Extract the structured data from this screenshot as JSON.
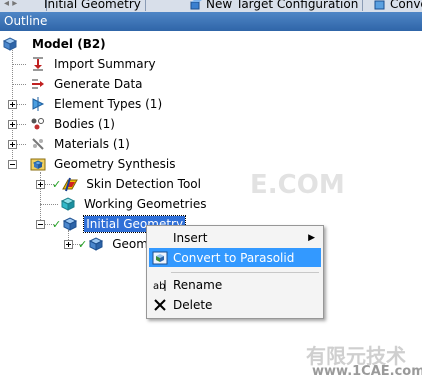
{
  "tabs": [
    {
      "label": "Initial Geometry",
      "icon": "geometry-icon"
    },
    {
      "label": "New Target Configuration",
      "icon": "cube-icon"
    },
    {
      "label": "Conve",
      "icon": "convert-icon"
    }
  ],
  "outline": {
    "title": "Outline"
  },
  "tree": {
    "root": "Model (B2)",
    "items": {
      "import_summary": "Import Summary",
      "generate_data": "Generate Data",
      "element_types": "Element Types (1)",
      "bodies": "Bodies (1)",
      "materials": "Materials (1)",
      "geometry_synthesis": "Geometry Synthesis",
      "skin_detection": "Skin Detection Tool",
      "working_geometries": "Working Geometries",
      "initial_geometry": "Initial Geometry",
      "geom_child": "Geom"
    }
  },
  "context_menu": {
    "insert": "Insert",
    "convert": "Convert to Parasolid",
    "rename": "Rename",
    "delete": "Delete"
  },
  "watermark": {
    "top": "E.COM",
    "cn": "有限元技术",
    "site": "www.1CAE.com"
  },
  "colors": {
    "header": "#2f65a8",
    "selection": "#3070d8",
    "menu_highlight": "#3399ff"
  }
}
